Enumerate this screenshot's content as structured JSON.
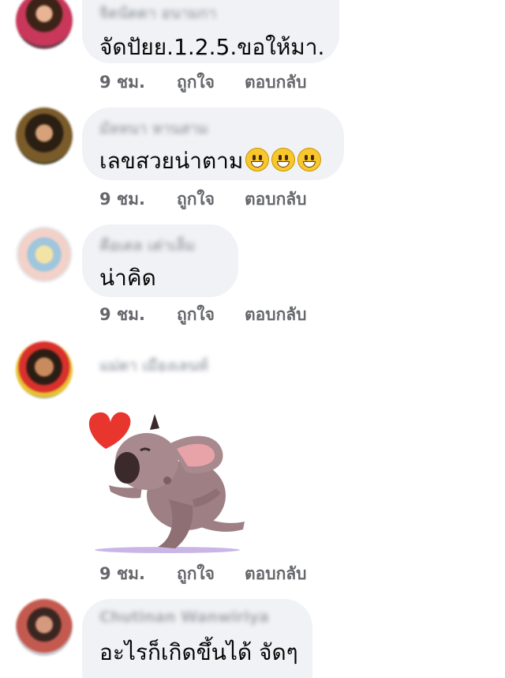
{
  "comments": [
    {
      "author": "จิดนัดดา อนามกา",
      "text": "จัดปัยย.1.2.5.ขอให้มา.",
      "time": "9 ชม.",
      "like": "ถูกใจ",
      "reply": "ตอบกลับ"
    },
    {
      "author": "มัลหนา หานสาม",
      "text": "เลขสวยน่าตาม",
      "time": "9 ชม.",
      "like": "ถูกใจ",
      "reply": "ตอบกลับ"
    },
    {
      "author": "คือเดล เต่าเล็ม",
      "text": "น่าคิด",
      "time": "9 ชม.",
      "like": "ถูกใจ",
      "reply": "ตอบกลับ"
    },
    {
      "author": "แม่ดา เมืองเลนท์",
      "text": "",
      "time": "9 ชม.",
      "like": "ถูกใจ",
      "reply": "ตอบกลับ"
    },
    {
      "author": "Chutinan Wanwiriya",
      "text": "อะไรก็เกิดขึ้นได้ จัดๆ",
      "time": "",
      "like": "",
      "reply": ""
    }
  ],
  "emoji_name": "grinning-face",
  "sticker_name": "dog-blowing-kiss-sticker",
  "colors": {
    "bubble": "#f0f2f5",
    "meta_text": "#65676b",
    "body_text": "#050505",
    "heart": "#e8362f"
  }
}
